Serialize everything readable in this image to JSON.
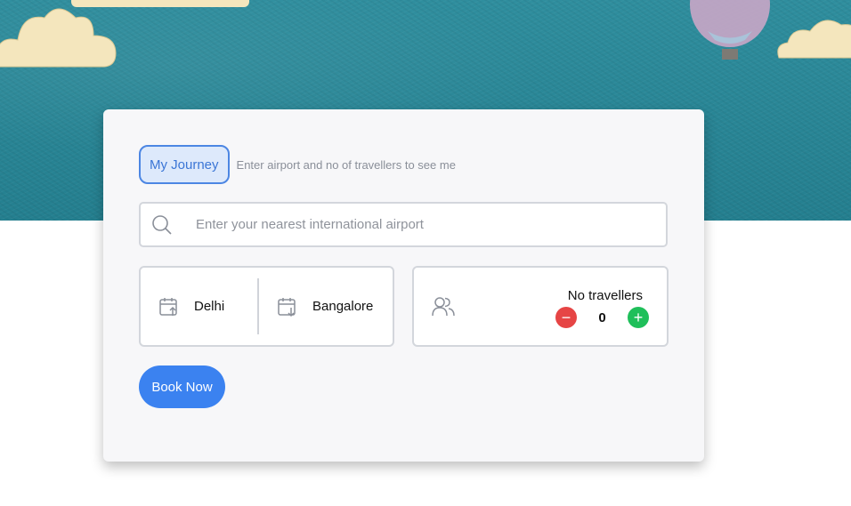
{
  "header": {
    "journey_chip": "My Journey",
    "journey_hint": "Enter airport and no of travellers to see me"
  },
  "search": {
    "placeholder": "Enter your nearest international airport",
    "value": "",
    "icon": "search-icon"
  },
  "route": {
    "from_city": "Delhi",
    "from_icon": "calendar-departure-icon",
    "to_city": "Bangalore",
    "to_icon": "calendar-arrival-icon"
  },
  "travellers": {
    "label": "No travellers",
    "count": "0",
    "icon": "users-icon",
    "decrement_symbol": "−",
    "increment_symbol": "+"
  },
  "actions": {
    "book_label": "Book Now"
  },
  "colors": {
    "hero": "#2b8a9a",
    "accent": "#3b82f0",
    "decrement": "#e64545",
    "increment": "#1fbf5a",
    "chip_border": "#4c86e3",
    "chip_bg": "#dde9fb"
  }
}
